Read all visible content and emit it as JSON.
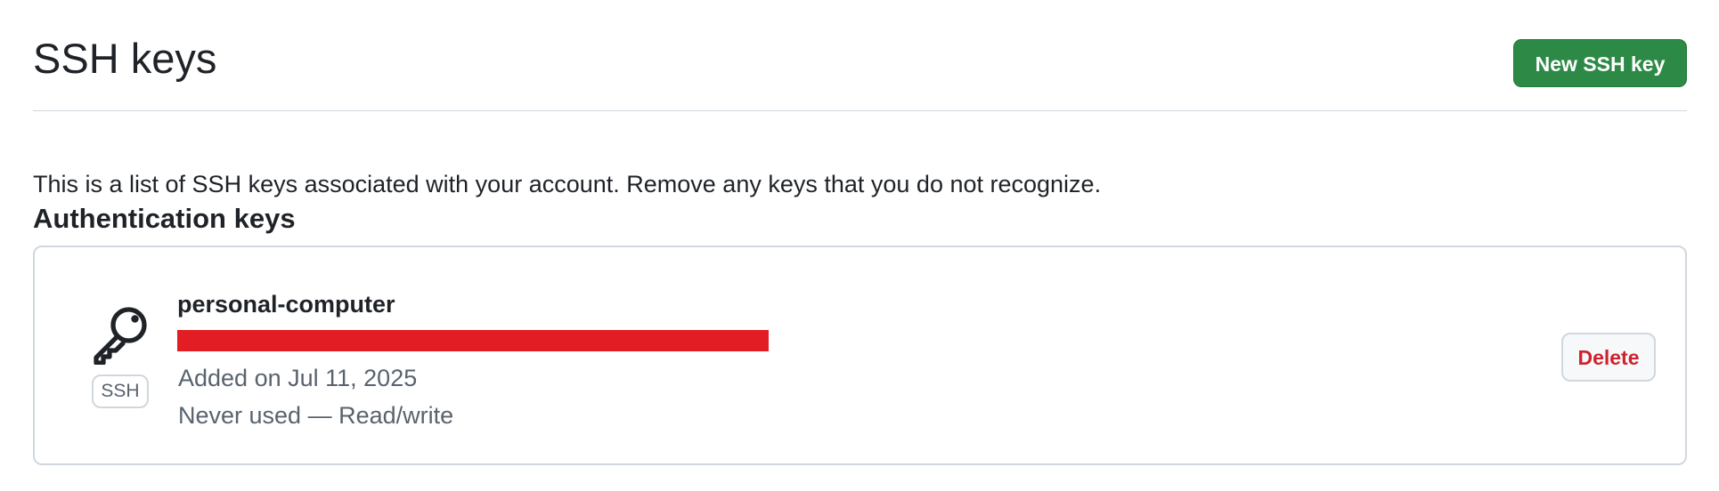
{
  "header": {
    "title": "SSH keys",
    "new_button_label": "New SSH key",
    "accent_color": "#2d8a46"
  },
  "description": "This is a list of SSH keys associated with your account. Remove any keys that you do not recognize.",
  "section": {
    "title": "Authentication keys"
  },
  "keys": [
    {
      "icon": "key-icon",
      "type_badge": "SSH",
      "title": "personal-computer",
      "fingerprint_redaction_color": "#e21d23",
      "added": "Added on Jul 11, 2025",
      "usage": "Never used — Read/write",
      "delete_label": "Delete",
      "delete_color": "#cf222e"
    }
  ]
}
